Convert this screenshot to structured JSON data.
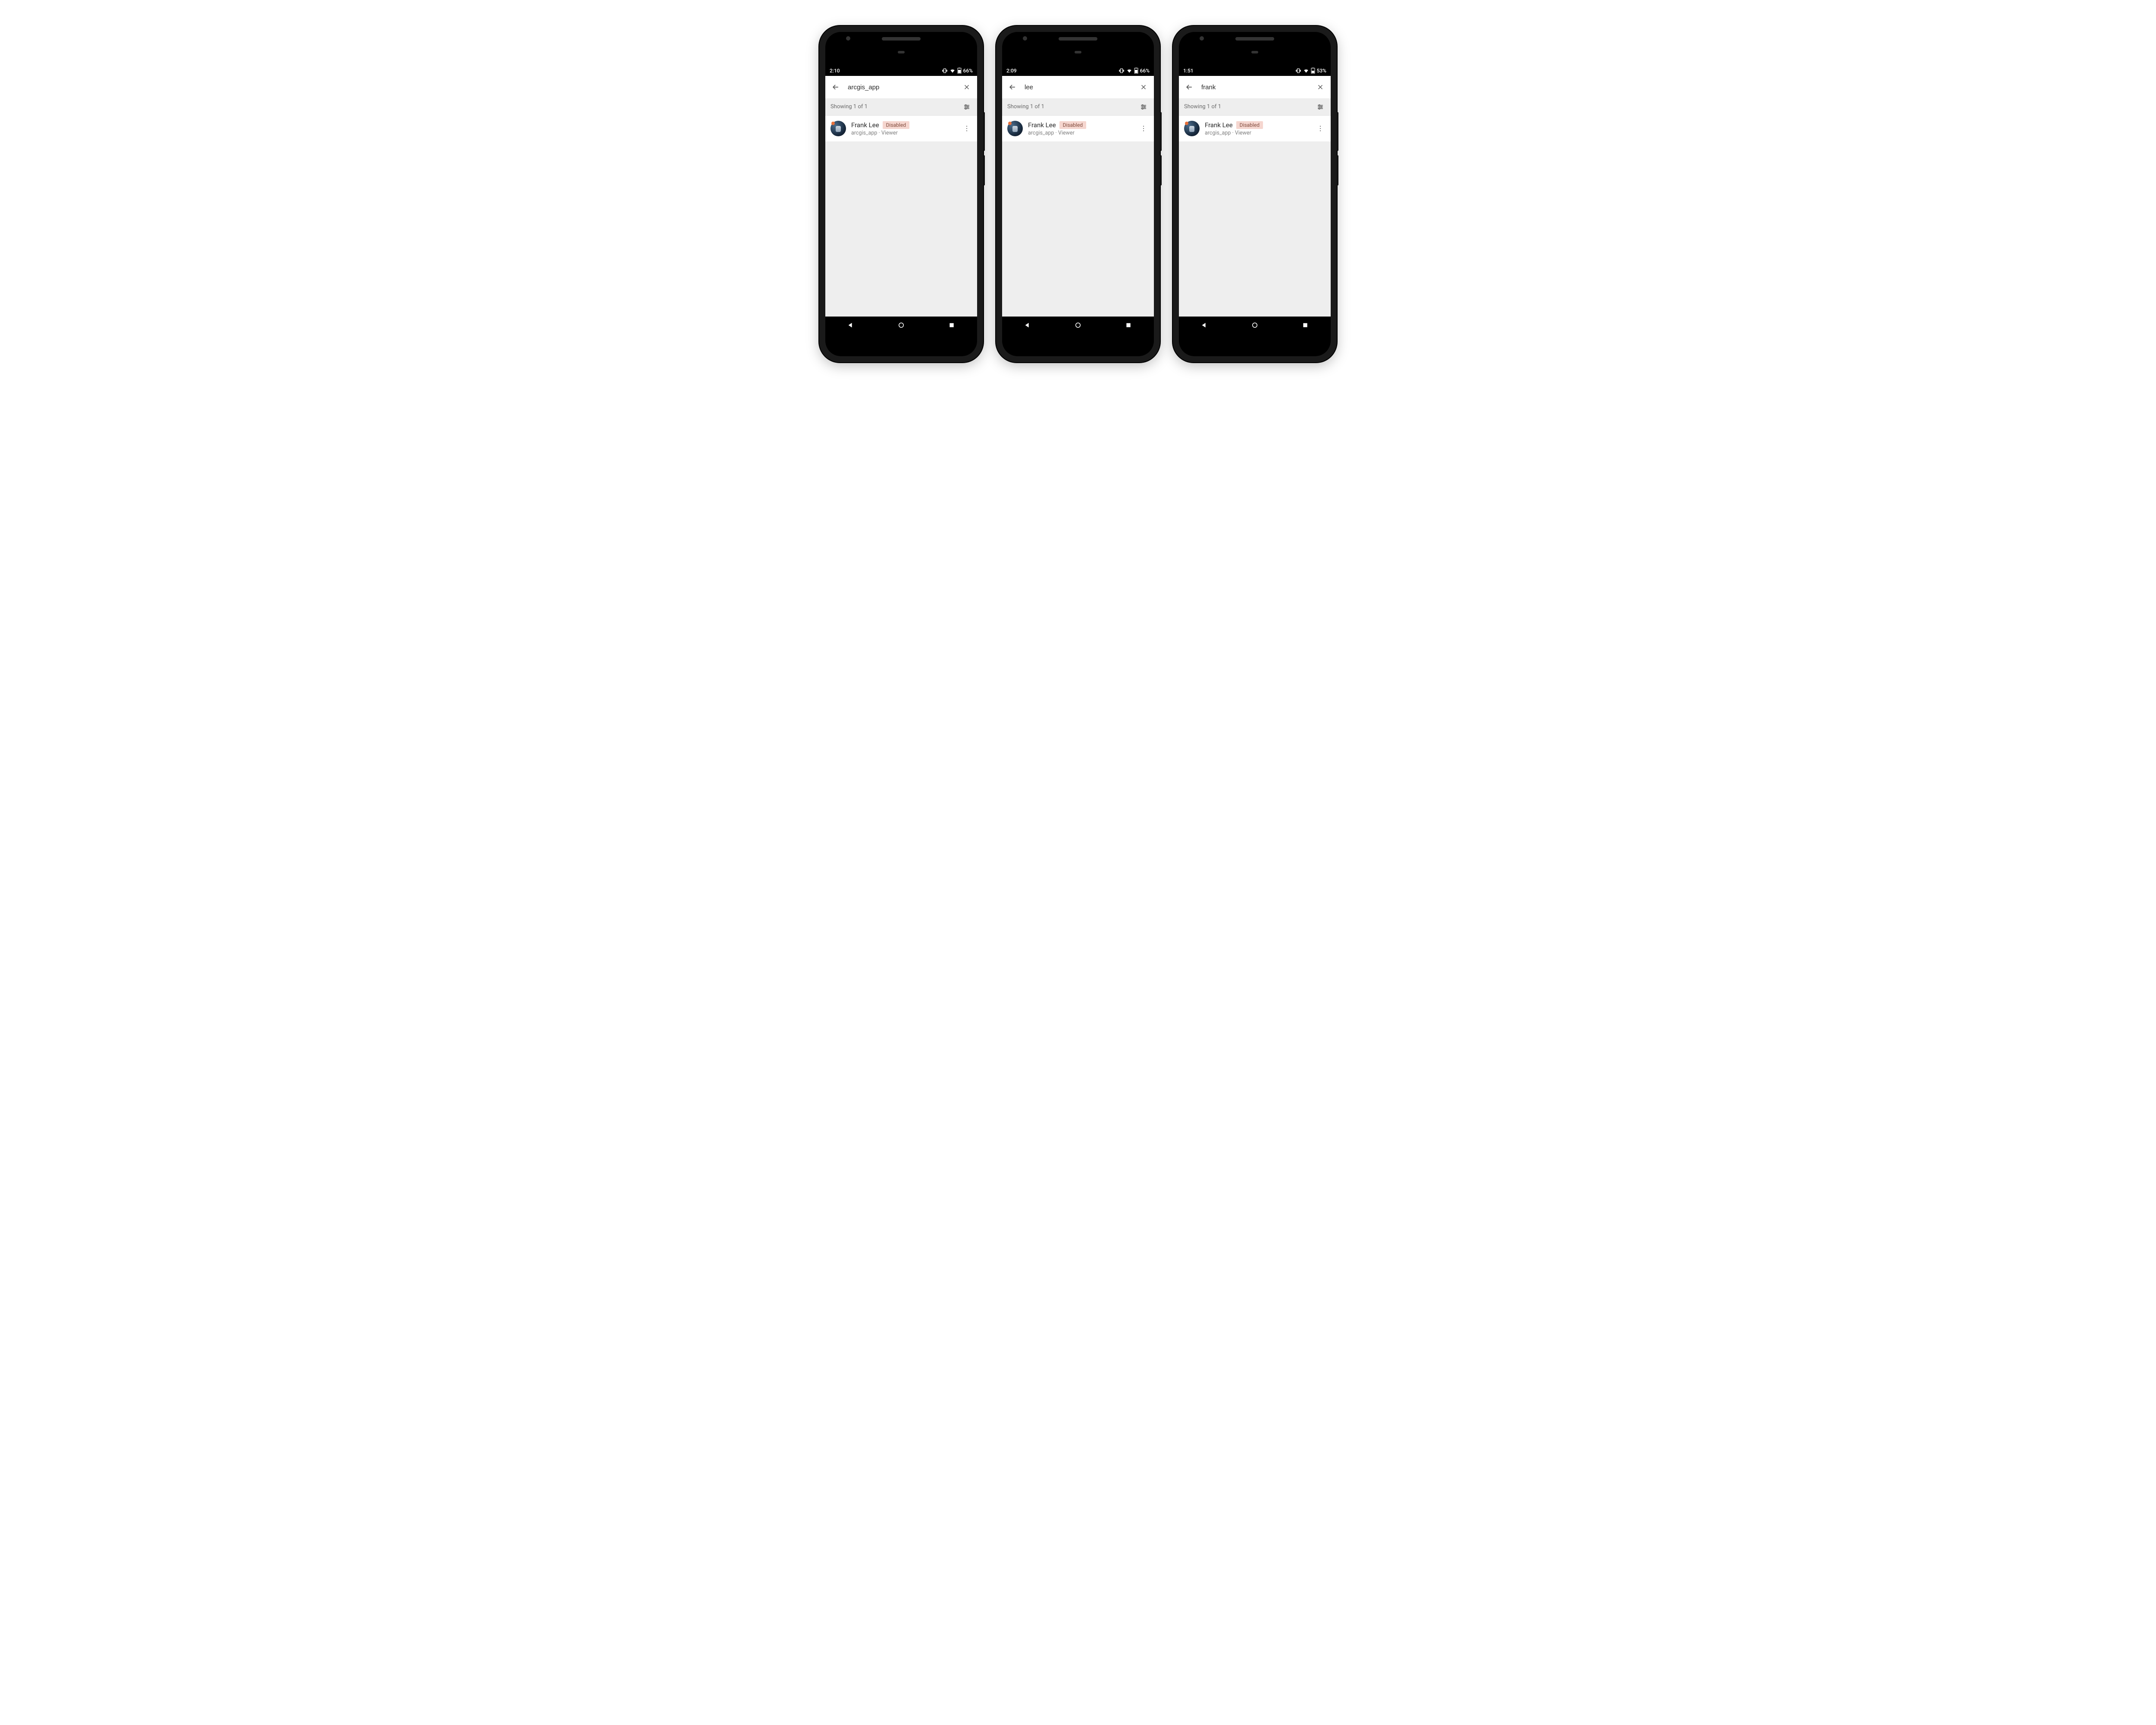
{
  "phones": [
    {
      "status": {
        "time": "2:10",
        "battery": "66%"
      },
      "search": {
        "query": "arcgis_app"
      },
      "filter": {
        "showing": "Showing 1 of 1"
      },
      "result": {
        "name": "Frank Lee",
        "badge": "Disabled",
        "subtitle": "arcgis_app · Viewer"
      }
    },
    {
      "status": {
        "time": "2:09",
        "battery": "66%"
      },
      "search": {
        "query": "lee"
      },
      "filter": {
        "showing": "Showing 1 of 1"
      },
      "result": {
        "name": "Frank Lee",
        "badge": "Disabled",
        "subtitle": "arcgis_app · Viewer"
      }
    },
    {
      "status": {
        "time": "1:51",
        "battery": "53%"
      },
      "search": {
        "query": "frank"
      },
      "filter": {
        "showing": "Showing 1 of 1"
      },
      "result": {
        "name": "Frank Lee",
        "badge": "Disabled",
        "subtitle": "arcgis_app · Viewer"
      }
    }
  ]
}
